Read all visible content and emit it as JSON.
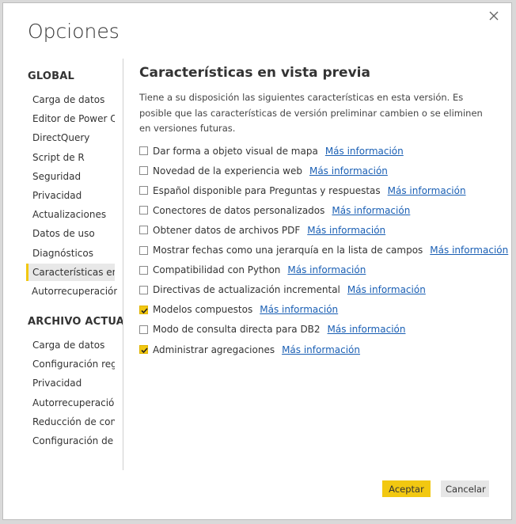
{
  "dialog": {
    "title": "Opciones",
    "close_icon": "close-icon"
  },
  "sidebar": {
    "global_title": "GLOBAL",
    "global_items": [
      "Carga de datos",
      "Editor de Power Query",
      "DirectQuery",
      "Script de R",
      "Seguridad",
      "Privacidad",
      "Actualizaciones",
      "Datos de uso",
      "Diagnósticos",
      "Características en vista previa",
      "Autorrecuperación"
    ],
    "selected_index": 9,
    "file_title": "ARCHIVO ACTUAL",
    "file_items": [
      "Carga de datos",
      "Configuración regional",
      "Privacidad",
      "Autorrecuperación",
      "Reducción de consultas",
      "Configuración de informe"
    ]
  },
  "content": {
    "title": "Características en vista previa",
    "description": "Tiene a su disposición las siguientes características en esta versión. Es posible que las características de versión preliminar cambien o se eliminen en versiones futuras.",
    "options": [
      {
        "label": "Dar forma a objeto visual de mapa",
        "link": "Más información",
        "checked": false
      },
      {
        "label": "Novedad de la experiencia web",
        "link": "Más información",
        "checked": false
      },
      {
        "label": "Español disponible para Preguntas y respuestas",
        "link": "Más información",
        "checked": false
      },
      {
        "label": "Conectores de datos personalizados",
        "link": "Más información",
        "checked": false
      },
      {
        "label": "Obtener datos de archivos PDF",
        "link": "Más información",
        "checked": false
      },
      {
        "label": "Mostrar fechas como una jerarquía en la lista de campos",
        "link": "Más información",
        "checked": false
      },
      {
        "label": "Compatibilidad con Python",
        "link": "Más información",
        "checked": false
      },
      {
        "label": "Directivas de actualización incremental",
        "link": "Más información",
        "checked": false
      },
      {
        "label": "Modelos compuestos",
        "link": "Más información",
        "checked": true
      },
      {
        "label": "Modo de consulta directa para DB2",
        "link": "Más información",
        "checked": false
      },
      {
        "label": "Administrar agregaciones",
        "link": "Más información",
        "checked": true
      }
    ]
  },
  "footer": {
    "ok_label": "Aceptar",
    "cancel_label": "Cancelar"
  },
  "colors": {
    "accent": "#f2c811",
    "link": "#1a5fb4"
  }
}
